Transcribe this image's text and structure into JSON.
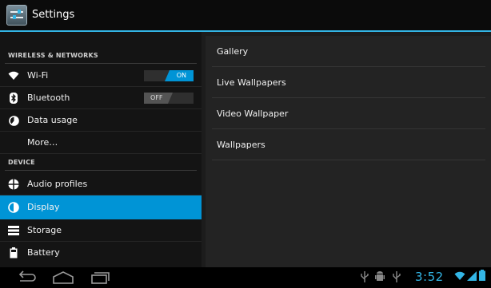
{
  "app": {
    "title": "Settings"
  },
  "sections": {
    "wireless": "WIRELESS & NETWORKS",
    "device": "DEVICE"
  },
  "wireless_items": [
    {
      "label": "Wi-Fi",
      "icon": "wifi-icon",
      "toggle": "ON"
    },
    {
      "label": "Bluetooth",
      "icon": "bluetooth-icon",
      "toggle": "OFF"
    },
    {
      "label": "Data usage",
      "icon": "data-usage-icon"
    },
    {
      "label": "More…"
    }
  ],
  "device_items": [
    {
      "label": "Audio profiles",
      "icon": "audio-profiles-icon"
    },
    {
      "label": "Display",
      "icon": "display-icon",
      "selected": true
    },
    {
      "label": "Storage",
      "icon": "storage-icon"
    },
    {
      "label": "Battery",
      "icon": "battery-icon"
    }
  ],
  "display_items": [
    {
      "label": "Gallery"
    },
    {
      "label": "Live Wallpapers"
    },
    {
      "label": "Video Wallpaper"
    },
    {
      "label": "Wallpapers"
    }
  ],
  "status_bar": {
    "time": "3:52"
  },
  "colors": {
    "accent": "#33b5e5",
    "selected": "#0094d6"
  }
}
